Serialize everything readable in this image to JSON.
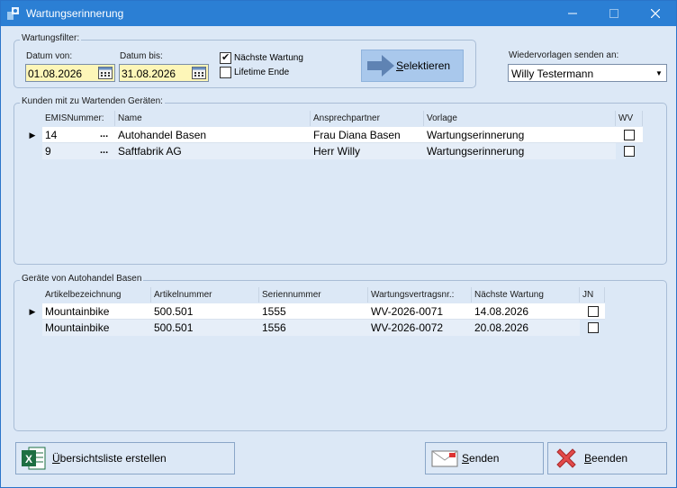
{
  "window": {
    "title": "Wartungserinnerung"
  },
  "filter": {
    "group_label": "Wartungsfilter:",
    "date_from_label": "Datum von:",
    "date_from_value": "01.08.2026",
    "date_to_label": "Datum bis:",
    "date_to_value": "31.08.2026",
    "next_maintenance_label": "Nächste Wartung",
    "next_maintenance_checked": true,
    "lifetime_end_label": "Lifetime Ende",
    "lifetime_end_checked": false,
    "select_button_label": "Selektieren"
  },
  "resubmit": {
    "label": "Wiedervorlagen senden an:",
    "selected": "Willy Testermann"
  },
  "customers": {
    "group_label": "Kunden mit zu Wartenden Geräten:",
    "columns": [
      "EMISNummer:",
      "Name",
      "Ansprechpartner",
      "Vorlage",
      "WV"
    ],
    "rows": [
      {
        "emis": "14",
        "name": "Autohandel Basen",
        "contact": "Frau Diana Basen",
        "template": "Wartungserinnerung",
        "wv": false
      },
      {
        "emis": "9",
        "name": "Saftfabrik AG",
        "contact": "Herr Willy",
        "template": "Wartungserinnerung",
        "wv": false
      }
    ]
  },
  "devices": {
    "group_label": "Geräte von Autohandel Basen",
    "columns": [
      "Artikelbezeichnung",
      "Artikelnummer",
      "Seriennummer",
      "Wartungsvertragsnr.:",
      "Nächste Wartung",
      "JN"
    ],
    "rows": [
      {
        "desc": "Mountainbike",
        "article": "500.501",
        "serial": "1555",
        "contract": "WV-2026-0071",
        "next": "14.08.2026",
        "jn": false
      },
      {
        "desc": "Mountainbike",
        "article": "500.501",
        "serial": "1556",
        "contract": "WV-2026-0072",
        "next": "20.08.2026",
        "jn": false
      }
    ]
  },
  "buttons": {
    "overview_label": "Übersichtsliste erstellen",
    "send_label": "Senden",
    "close_label": "Beenden"
  },
  "colors": {
    "titlebar": "#2b7fd4",
    "window_bg": "#dce8f6",
    "date_bg": "#fdf6b8",
    "select_button_bg": "#a9c8ec"
  }
}
